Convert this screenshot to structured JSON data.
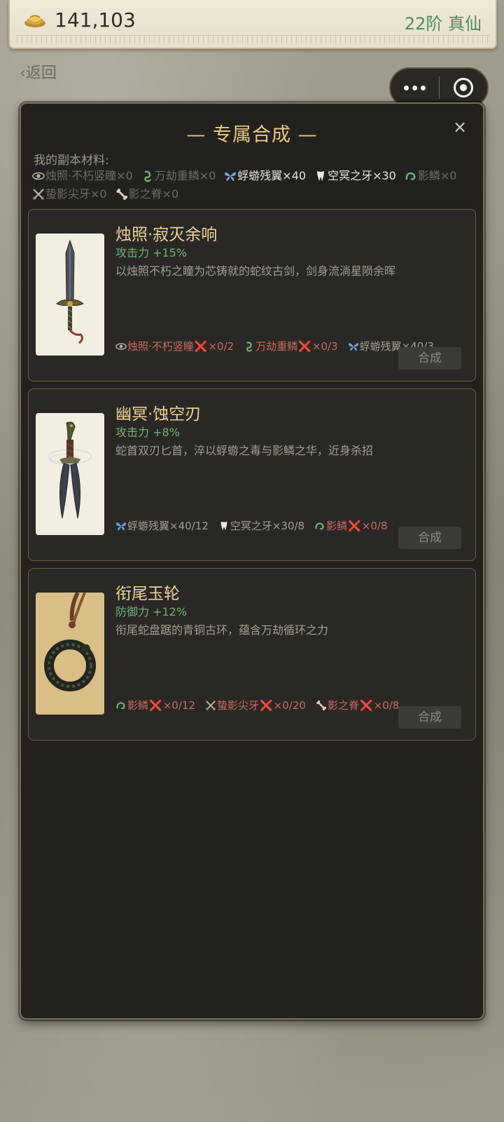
{
  "topbar": {
    "currency_amount": "141,103",
    "rank": "22阶 真仙"
  },
  "nav": {
    "back_label": "返回"
  },
  "panel": {
    "title": "— 专属合成 —",
    "close_glyph": "×",
    "materials_label": "我的副本材料:",
    "materials": [
      {
        "icon": "eye-icon",
        "text": "烛照·不朽竖瞳×0",
        "state": "zero"
      },
      {
        "icon": "serpent-coil-icon",
        "text": "万劫重鳞×0",
        "state": "zero"
      },
      {
        "icon": "butterfly-icon",
        "text": "蜉蝣残翼×40",
        "state": "have"
      },
      {
        "icon": "fang-icon",
        "text": "空冥之牙×30",
        "state": "have"
      },
      {
        "icon": "snake-icon",
        "text": "影鳞×0",
        "state": "zero"
      },
      {
        "icon": "crossed-blades-icon",
        "text": "蛰影尖牙×0",
        "state": "zero"
      },
      {
        "icon": "bone-icon",
        "text": "影之脊×0",
        "state": "zero"
      }
    ]
  },
  "recipes": [
    {
      "name": "烛照·寂灭余响",
      "stat": "攻击力 +15%",
      "desc": "以烛照不朽之瞳为芯铸就的蛇纹古剑，剑身流淌星陨余晖",
      "craft_label": "合成",
      "requirements": [
        {
          "icon": "eye-icon",
          "name": "烛照·不朽竖瞳",
          "mark": "❌",
          "count": "×0/2",
          "ok": false
        },
        {
          "icon": "serpent-coil-icon",
          "name": "万劫重鳞",
          "mark": "❌",
          "count": "×0/3",
          "ok": false
        },
        {
          "icon": "butterfly-icon",
          "name": "蜉蝣残翼",
          "mark": "",
          "count": "×40/3",
          "ok": true
        }
      ]
    },
    {
      "name": "幽冥·蚀空刃",
      "stat": "攻击力 +8%",
      "desc": "蛇首双刃匕首，淬以蜉蝣之毒与影鳞之华，近身杀招",
      "craft_label": "合成",
      "requirements": [
        {
          "icon": "butterfly-icon",
          "name": "蜉蝣残翼",
          "mark": "",
          "count": "×40/12",
          "ok": true
        },
        {
          "icon": "fang-icon",
          "name": "空冥之牙",
          "mark": "",
          "count": "×30/8",
          "ok": true
        },
        {
          "icon": "snake-icon",
          "name": "影鳞",
          "mark": "❌",
          "count": "×0/8",
          "ok": false
        }
      ]
    },
    {
      "name": "衔尾玉轮",
      "stat": "防御力 +12%",
      "desc": "衔尾蛇盘踞的青铜古环，蕴含万劫循环之力",
      "craft_label": "合成",
      "requirements": [
        {
          "icon": "snake-icon",
          "name": "影鳞",
          "mark": "❌",
          "count": "×0/12",
          "ok": false
        },
        {
          "icon": "crossed-blades-icon",
          "name": "蛰影尖牙",
          "mark": "❌",
          "count": "×0/20",
          "ok": false
        },
        {
          "icon": "bone-icon",
          "name": "影之脊",
          "mark": "❌",
          "count": "×0/8",
          "ok": false
        }
      ]
    }
  ],
  "colors": {
    "title_gold": "#e6c884",
    "stat_green": "#6fb079",
    "missing_red": "#c76a62",
    "rank_green": "#4f8a61"
  }
}
